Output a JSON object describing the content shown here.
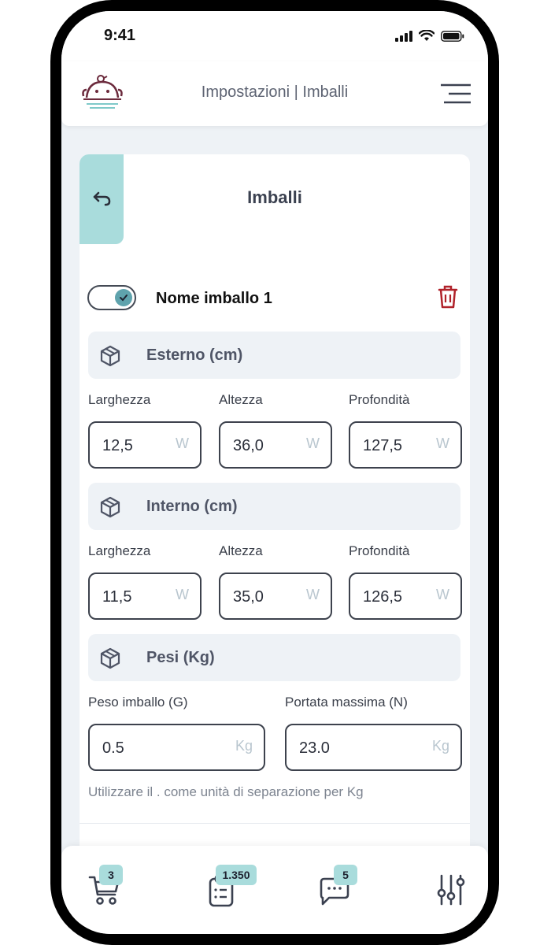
{
  "status_bar": {
    "time": "9:41",
    "icons": [
      "signal-icon",
      "wifi-icon",
      "battery-icon"
    ]
  },
  "header": {
    "title": "Impostazioni | Imballi",
    "logo": "mascot-logo",
    "menu_icon": "hamburger-menu-icon"
  },
  "card": {
    "title": "Imballi",
    "back_icon": "back-arrow-icon",
    "package": {
      "name": "Nome imballo 1",
      "enabled": true,
      "delete_icon": "trash-icon"
    },
    "sections": {
      "external": {
        "label": "Esterno (cm)",
        "fields": [
          {
            "label": "Larghezza",
            "value": "12,5",
            "unit": "W"
          },
          {
            "label": "Altezza",
            "value": "36,0",
            "unit": "W"
          },
          {
            "label": "Profondità",
            "value": "127,5",
            "unit": "W"
          }
        ]
      },
      "internal": {
        "label": "Interno (cm)",
        "fields": [
          {
            "label": "Larghezza",
            "value": "11,5",
            "unit": "W"
          },
          {
            "label": "Altezza",
            "value": "35,0",
            "unit": "W"
          },
          {
            "label": "Profondità",
            "value": "126,5",
            "unit": "W"
          }
        ]
      },
      "weights": {
        "label": "Pesi (Kg)",
        "fields": [
          {
            "label": "Peso imballo (G)",
            "value": "0.5",
            "unit": "Kg"
          },
          {
            "label": "Portata massima (N)",
            "value": "23.0",
            "unit": "Kg"
          }
        ],
        "hint": "Utilizzare il . come unità di separazione per Kg"
      }
    }
  },
  "bottom_nav": [
    {
      "name": "cart",
      "icon": "cart-icon",
      "badge": "3"
    },
    {
      "name": "orders",
      "icon": "clipboard-icon",
      "badge": "1.350"
    },
    {
      "name": "messages",
      "icon": "chat-icon",
      "badge": "5"
    },
    {
      "name": "settings",
      "icon": "sliders-icon",
      "badge": null
    }
  ],
  "colors": {
    "accent": "#a9dcdc",
    "toggle_knob": "#5fa3ad",
    "danger": "#b0222a",
    "background": "#eef2f6"
  }
}
